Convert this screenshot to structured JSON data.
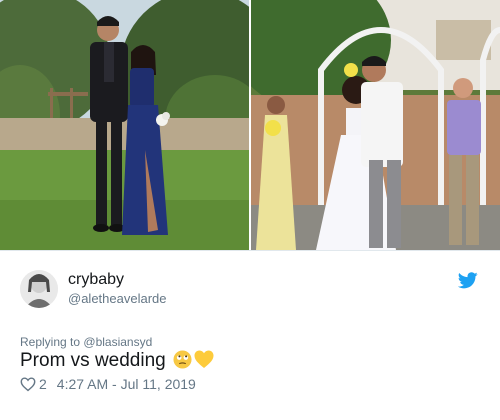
{
  "photos": {
    "left": {
      "icon": "prom-photo"
    },
    "right": {
      "icon": "wedding-photo"
    }
  },
  "tweet": {
    "display_name": "crybaby",
    "handle": "@aletheavelarde",
    "replying_label": "Replying to",
    "replying_to": "@blasiansyd",
    "text": "Prom vs wedding",
    "emojis": [
      "face-with-rolling-eyes",
      "yellow-heart"
    ],
    "likes": "2",
    "timestamp": "4:27 AM - Jul 11, 2019"
  },
  "colors": {
    "twitter_blue": "#1da1f2",
    "secondary_text": "#657786",
    "primary_text": "#14171a",
    "divider": "#e1e8ed"
  }
}
